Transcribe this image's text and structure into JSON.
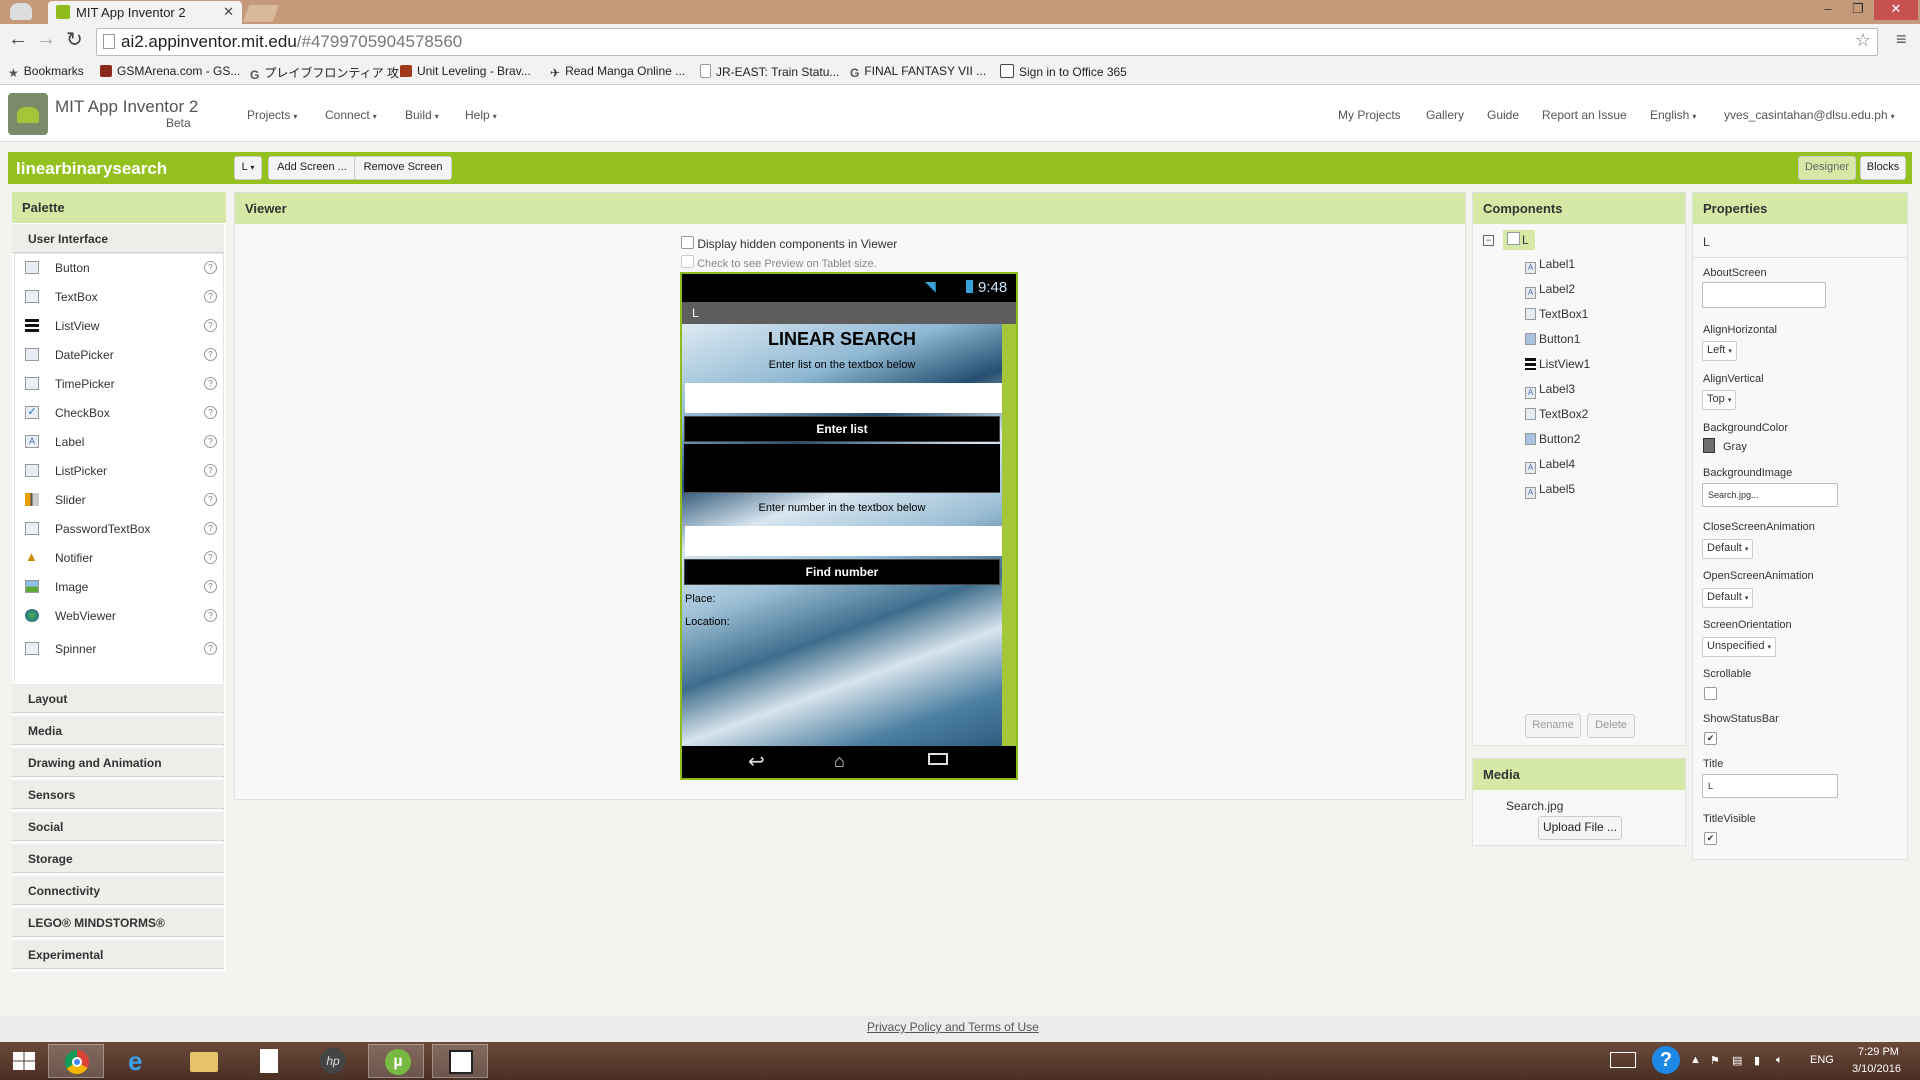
{
  "browser": {
    "tab_title": "MIT App Inventor 2",
    "url_host": "ai2.appinventor.mit.edu",
    "url_path": "/#4799705904578560",
    "bookmarks": [
      "Bookmarks",
      "GSMArena.com - GS...",
      "プレイブフロンティア 攻...",
      "Unit Leveling - Brav...",
      "Read Manga Online ...",
      "JR-EAST: Train Statu...",
      "FINAL FANTASY VII ...",
      "Sign in to Office 365"
    ]
  },
  "app": {
    "title": "MIT App Inventor 2",
    "beta": "Beta",
    "menus": [
      "Projects",
      "Connect",
      "Build",
      "Help"
    ],
    "right_links": [
      "My Projects",
      "Gallery",
      "Guide",
      "Report an Issue"
    ],
    "language": "English",
    "user": "yves_casintahan@dlsu.edu.ph"
  },
  "project": {
    "name": "linearbinarysearch",
    "screen_dropdown": "L",
    "add_screen": "Add Screen ...",
    "remove_screen": "Remove Screen",
    "designer": "Designer",
    "blocks": "Blocks"
  },
  "palette": {
    "header": "Palette",
    "section": "User Interface",
    "items": [
      "Button",
      "TextBox",
      "ListView",
      "DatePicker",
      "TimePicker",
      "CheckBox",
      "Label",
      "ListPicker",
      "Slider",
      "PasswordTextBox",
      "Notifier",
      "Image",
      "WebViewer",
      "Spinner"
    ],
    "help": "?",
    "drawers": [
      "Layout",
      "Media",
      "Drawing and Animation",
      "Sensors",
      "Social",
      "Storage",
      "Connectivity",
      "LEGO® MINDSTORMS®",
      "Experimental"
    ]
  },
  "viewer": {
    "header": "Viewer",
    "hidden_label": "Display hidden components in Viewer",
    "tablet_label": "Check to see Preview on Tablet size.",
    "phone": {
      "time": "9:48",
      "screen_title": "L",
      "heading": "LINEAR SEARCH",
      "list_hint": "Enter list on the textbox below",
      "enter_button": "Enter list",
      "number_hint": "Enter number in the textbox below",
      "find_button": "Find number",
      "place": "Place:",
      "location": "Location:"
    }
  },
  "components": {
    "header": "Components",
    "root": "L",
    "items": [
      "Label1",
      "Label2",
      "TextBox1",
      "Button1",
      "ListView1",
      "Label3",
      "TextBox2",
      "Button2",
      "Label4",
      "Label5"
    ],
    "rename": "Rename",
    "delete": "Delete"
  },
  "media": {
    "header": "Media",
    "file": "Search.jpg",
    "upload": "Upload File ..."
  },
  "properties": {
    "header": "Properties",
    "component": "L",
    "about_screen": "AboutScreen",
    "align_horizontal": "AlignHorizontal",
    "align_horizontal_value": "Left",
    "align_vertical": "AlignVertical",
    "align_vertical_value": "Top",
    "background_color": "BackgroundColor",
    "background_color_value": "Gray",
    "background_image": "BackgroundImage",
    "background_image_value": "Search.jpg...",
    "close_anim": "CloseScreenAnimation",
    "close_anim_value": "Default",
    "open_anim": "OpenScreenAnimation",
    "open_anim_value": "Default",
    "orientation": "ScreenOrientation",
    "orientation_value": "Unspecified",
    "scrollable": "Scrollable",
    "scrollable_checked": false,
    "show_status_bar": "ShowStatusBar",
    "show_status_bar_checked": true,
    "title": "Title",
    "title_value": "L",
    "title_visible": "TitleVisible",
    "title_visible_checked": true
  },
  "footer": {
    "privacy": "Privacy Policy and Terms of Use"
  },
  "taskbar": {
    "lang": "ENG",
    "time": "7:29 PM",
    "date": "3/10/2016"
  },
  "colors": {
    "green": "#95c11f",
    "panel_header": "#d6e8a5"
  }
}
